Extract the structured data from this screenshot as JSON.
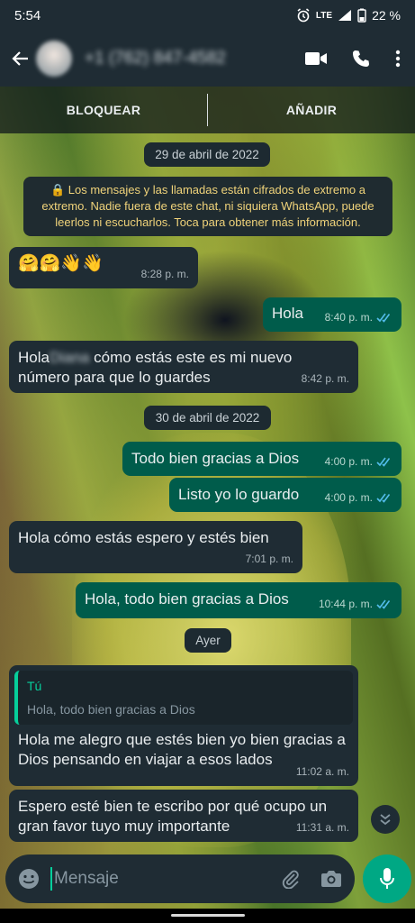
{
  "status_bar": {
    "time": "5:54",
    "network": "LTE",
    "battery": "22 %"
  },
  "app_bar": {
    "contact": "+1 (762) 847-4582"
  },
  "action_bar": {
    "block": "BLOQUEAR",
    "add": "AÑADIR"
  },
  "dates": {
    "d1": "29 de abril de 2022",
    "d2": "30 de abril de 2022",
    "d3": "Ayer"
  },
  "encryption_notice": "🔒 Los mensajes y las llamadas están cifrados de extremo a extremo. Nadie fuera de este chat, ni siquiera WhatsApp, puede leerlos ni escucharlos. Toca para obtener más información.",
  "messages": [
    {
      "dir": "in",
      "text": "🤗🤗👋👋",
      "time": "8:28 p. m."
    },
    {
      "dir": "out",
      "text": "Hola",
      "time": "8:40 p. m."
    },
    {
      "dir": "in",
      "text_start": "Hola",
      "text_blurred": "Diana",
      "text_end": " cómo estás este es mi nuevo número para que lo guardes",
      "time": "8:42 p. m."
    },
    {
      "dir": "out",
      "text": "Todo bien gracias a Dios",
      "time": "4:00 p. m."
    },
    {
      "dir": "out",
      "text": "Listo yo lo guardo",
      "time": "4:00 p. m."
    },
    {
      "dir": "in",
      "text": "Hola cómo estás espero y estés bien",
      "time": "7:01 p. m."
    },
    {
      "dir": "out",
      "text": "Hola, todo bien gracias a Dios",
      "time": "10:44 p. m."
    },
    {
      "dir": "in",
      "reply_author": "Tú",
      "reply_text": "Hola, todo bien gracias a Dios",
      "text": "Hola me alegro que estés bien yo bien gracias a Dios pensando en viajar a esos lados",
      "time": "11:02 a. m."
    },
    {
      "dir": "in",
      "text": "Espero esté bien te escribo por qué ocupo un gran favor tuyo muy importante",
      "time": "11:31 a. m."
    }
  ],
  "composer": {
    "placeholder": "Mensaje"
  },
  "colors": {
    "outgoing": "#005c4b",
    "incoming": "#1f2c34",
    "accent": "#00a884",
    "read_ticks": "#53bdeb"
  }
}
